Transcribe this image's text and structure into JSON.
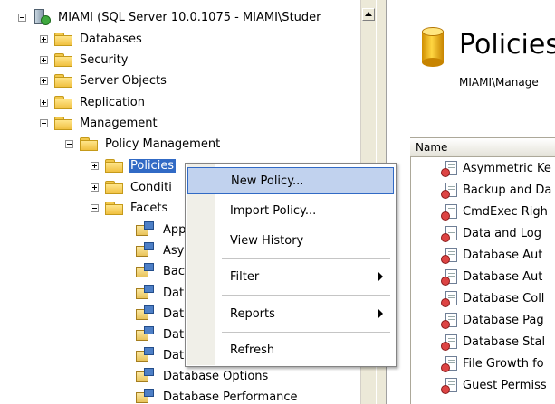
{
  "tree": {
    "server_label": "MIAMI (SQL Server 10.0.1075 - MIAMI\\Studer",
    "nodes": [
      {
        "label": "Databases"
      },
      {
        "label": "Security"
      },
      {
        "label": "Server Objects"
      },
      {
        "label": "Replication"
      },
      {
        "label": "Management"
      },
      {
        "label": "Policy Management"
      },
      {
        "label": "Policies"
      },
      {
        "label": "Conditi"
      },
      {
        "label": "Facets"
      }
    ],
    "facets": [
      "App",
      "Asy",
      "Bac",
      "Dat",
      "Dat",
      "Dat",
      "Dat",
      "Database Options",
      "Database Performance"
    ]
  },
  "context_menu": {
    "items": [
      {
        "label": "New Policy..."
      },
      {
        "label": "Import Policy..."
      },
      {
        "label": "View History"
      },
      {
        "label": "Filter"
      },
      {
        "label": "Reports"
      },
      {
        "label": "Refresh"
      }
    ]
  },
  "right_pane": {
    "title": "Policies",
    "subtitle": "MIAMI\\Manage",
    "column_header": "Name",
    "policies": [
      "Asymmetric Ke",
      "Backup and Da",
      "CmdExec Righ",
      "Data and Log",
      "Database Aut",
      "Database Aut",
      "Database Coll",
      "Database Pag",
      "Database Stal",
      "File Growth fo",
      "Guest Permiss"
    ]
  },
  "colors": {
    "selection": "#316ac5",
    "menu_hover": "#c1d2ee",
    "chrome": "#ece9d8"
  }
}
